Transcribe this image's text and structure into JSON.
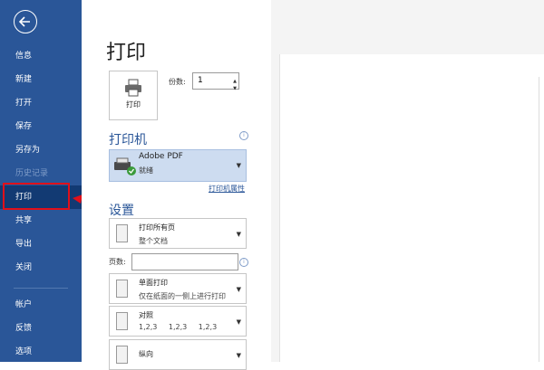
{
  "sidebar": {
    "items": [
      {
        "label": "信息"
      },
      {
        "label": "新建"
      },
      {
        "label": "打开"
      },
      {
        "label": "保存"
      },
      {
        "label": "另存为"
      },
      {
        "label": "历史记录"
      },
      {
        "label": "打印"
      },
      {
        "label": "共享"
      },
      {
        "label": "导出"
      },
      {
        "label": "关闭"
      },
      {
        "label": "帐户"
      },
      {
        "label": "反馈"
      },
      {
        "label": "选项"
      }
    ]
  },
  "main": {
    "title": "打印",
    "print_button": "打印",
    "copies_label": "份数:",
    "copies_value": "1",
    "printer_section": "打印机",
    "printer_name": "Adobe PDF",
    "printer_status": "就绪",
    "printer_properties": "打印机属性",
    "settings_section": "设置",
    "print_range": {
      "line1": "打印所有页",
      "line2": "整个文档"
    },
    "pages_label": "页数:",
    "pages_value": "",
    "sides": {
      "line1": "单面打印",
      "line2": "仅在纸面的一侧上进行打印"
    },
    "collate": {
      "line1": "对照",
      "line2": "1,2,3   1,2,3   1,2,3"
    },
    "orientation": {
      "line1": "纵向"
    }
  },
  "colors": {
    "sidebar": "#2a5698",
    "accent": "#2a5698",
    "highlight": "#e0101a"
  },
  "icons": [
    "back-arrow-icon",
    "printer-icon",
    "info-icon",
    "dropdown-arrow-icon"
  ]
}
